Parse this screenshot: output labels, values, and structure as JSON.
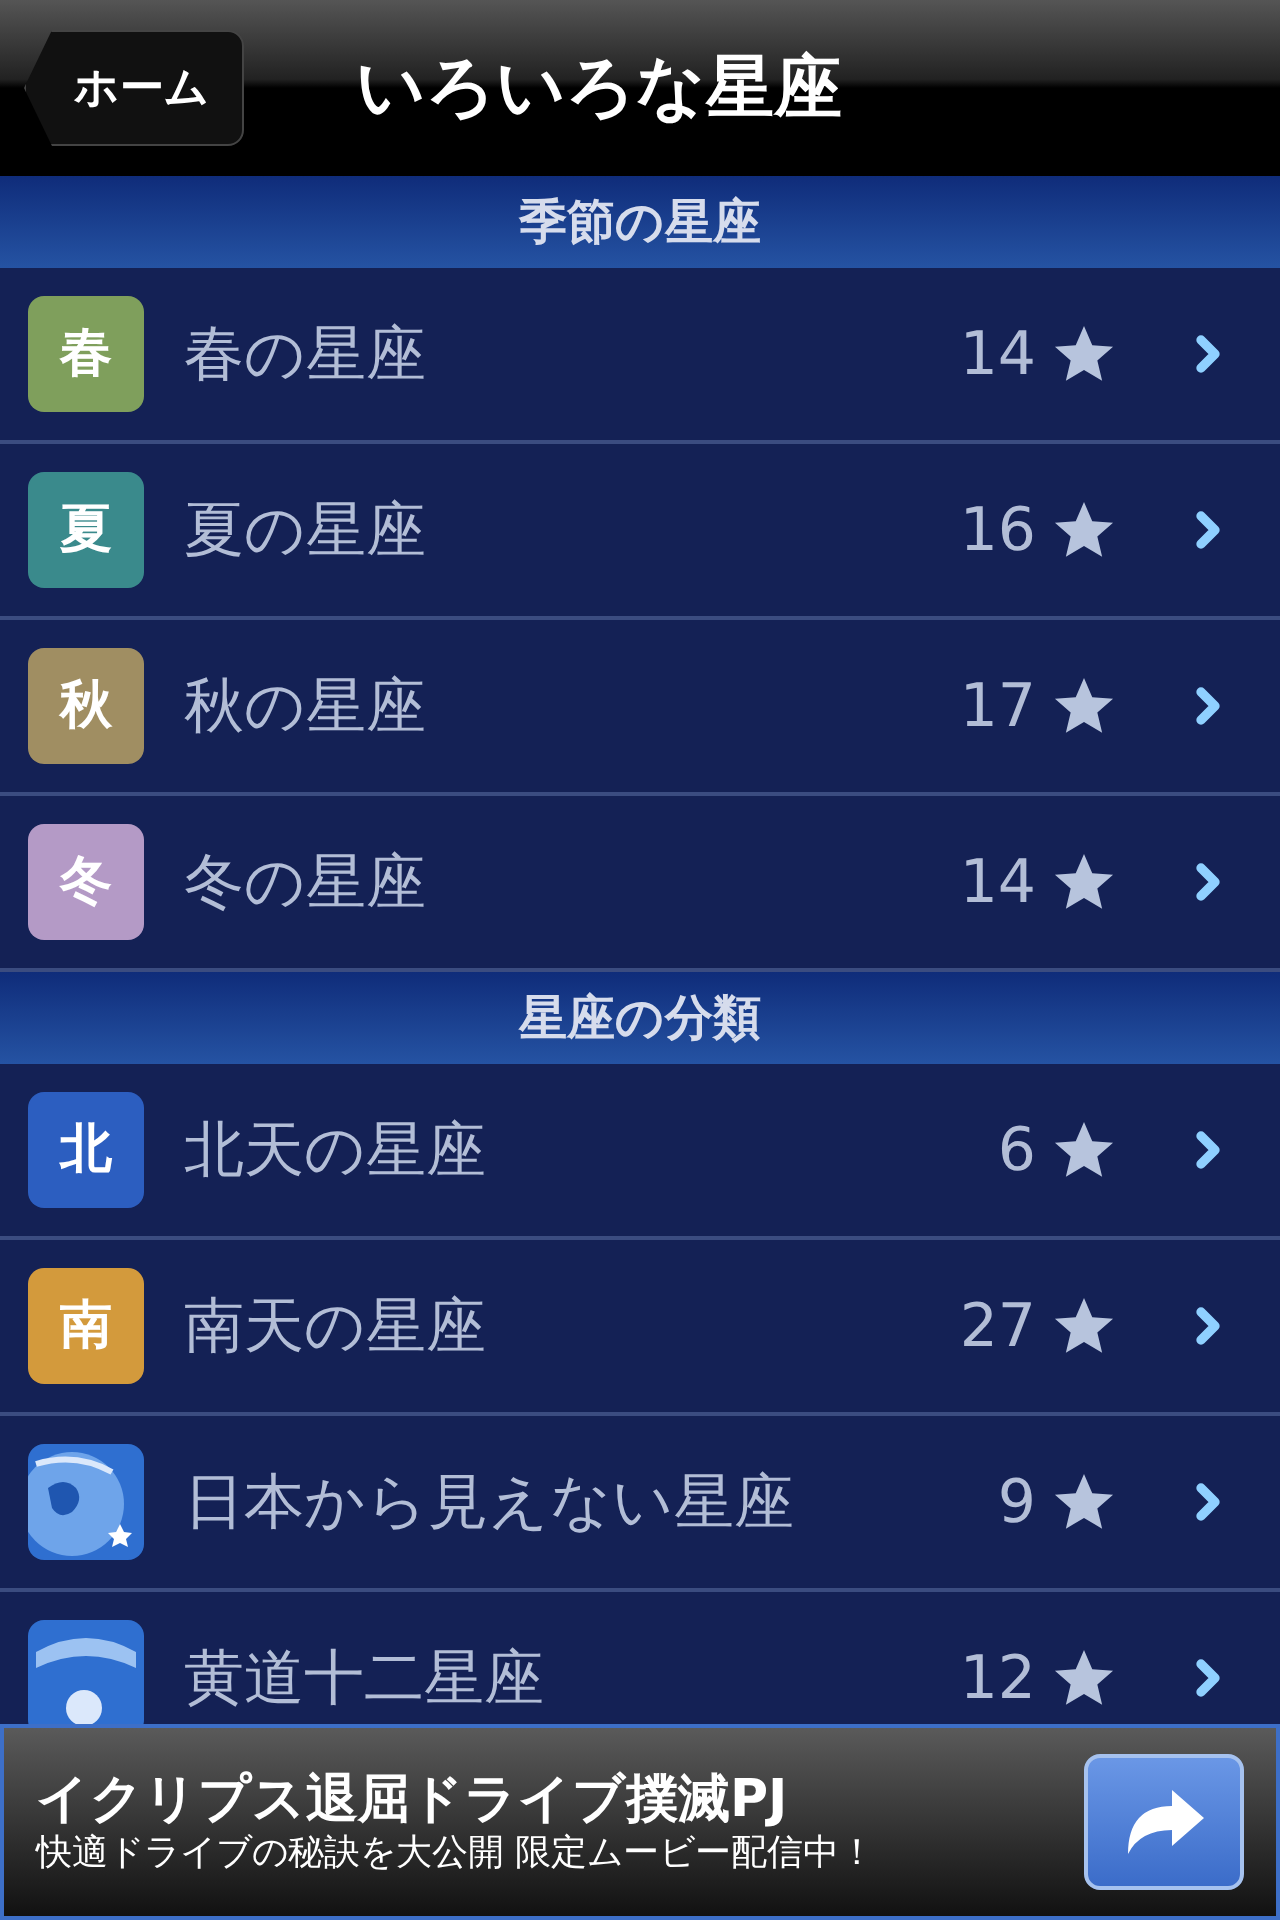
{
  "nav": {
    "back": "ホーム",
    "title": "いろいろな星座"
  },
  "sections": [
    {
      "title": "季節の星座",
      "rows": [
        {
          "kind": "badge",
          "badge": "春",
          "color": "#7f9f5c",
          "label": "春の星座",
          "count": "14"
        },
        {
          "kind": "badge",
          "badge": "夏",
          "color": "#3a8a8c",
          "label": "夏の星座",
          "count": "16"
        },
        {
          "kind": "badge",
          "badge": "秋",
          "color": "#a08e62",
          "label": "秋の星座",
          "count": "17"
        },
        {
          "kind": "badge",
          "badge": "冬",
          "color": "#b49ac6",
          "label": "冬の星座",
          "count": "14"
        }
      ]
    },
    {
      "title": "星座の分類",
      "rows": [
        {
          "kind": "badge",
          "badge": "北",
          "color": "#2c5ec0",
          "label": "北天の星座",
          "count": "6"
        },
        {
          "kind": "badge",
          "badge": "南",
          "color": "#d39a3c",
          "label": "南天の星座",
          "count": "27"
        },
        {
          "kind": "globe",
          "label": "日本から見えない星座",
          "count": "9"
        },
        {
          "kind": "sun",
          "label": "黄道十二星座",
          "count": "12"
        }
      ]
    }
  ],
  "ad": {
    "title": "イクリプス退屈ドライブ撲滅PJ",
    "text": "快適ドライブの秘訣を大公開 限定ムービー配信中！"
  }
}
